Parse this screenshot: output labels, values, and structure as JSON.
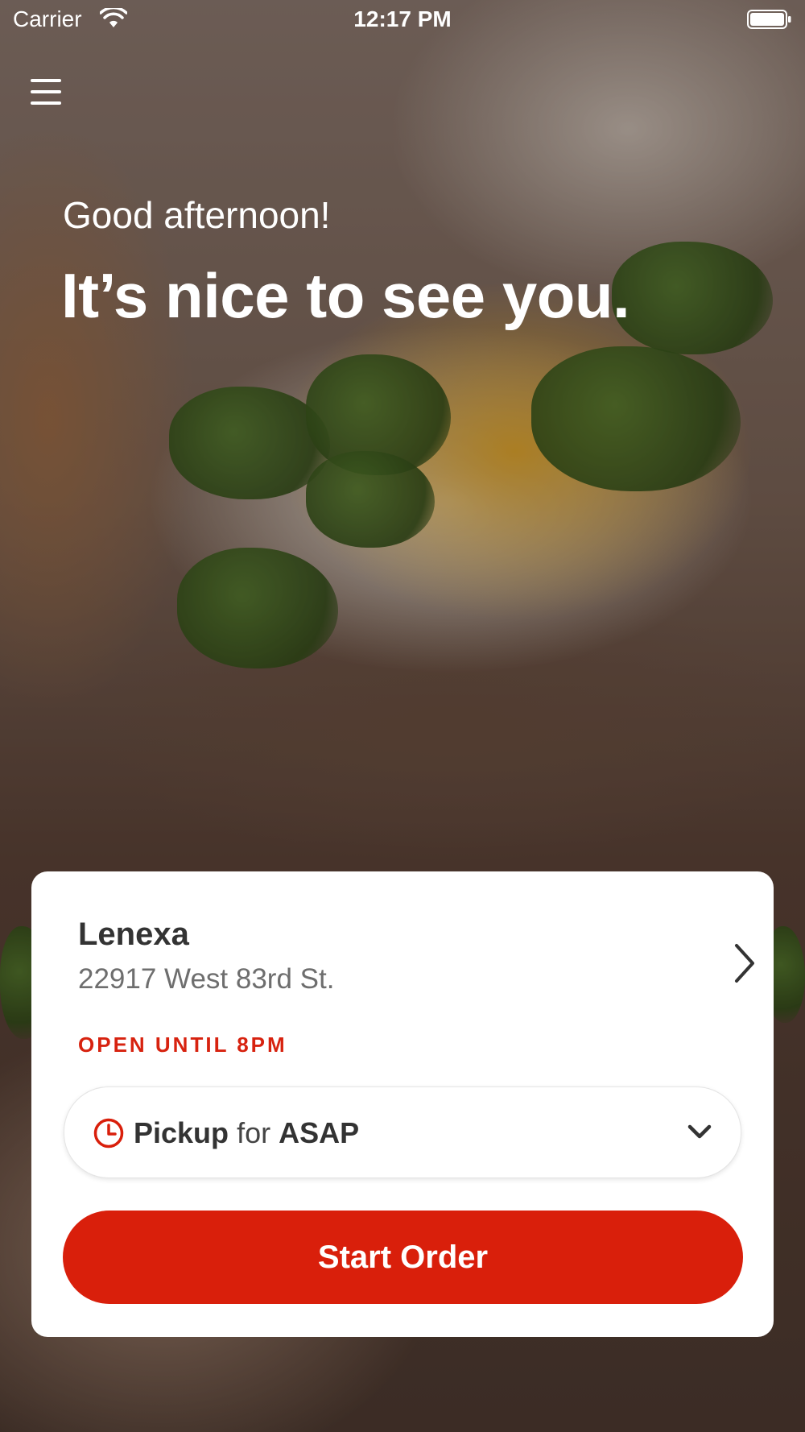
{
  "status_bar": {
    "carrier": "Carrier",
    "time": "12:17 PM"
  },
  "greeting": {
    "line1": "Good afternoon!",
    "line2": "It’s nice to see you."
  },
  "location": {
    "name": "Lenexa",
    "address": "22917 West 83rd St.",
    "open_status": "OPEN UNTIL 8PM"
  },
  "order_mode": {
    "mode": "Pickup",
    "connector": "for",
    "time": "ASAP"
  },
  "actions": {
    "start_order_label": "Start Order"
  },
  "icons": {
    "menu": "hamburger-menu-icon",
    "wifi": "wifi-icon",
    "battery": "battery-icon",
    "location_chevron": "chevron-right-icon",
    "clock": "clock-icon",
    "dropdown": "chevron-down-icon"
  },
  "colors": {
    "accent": "#d91f0b",
    "open_status": "#d7220f",
    "text_dark": "#333333",
    "text_muted": "#6e6e6e"
  }
}
